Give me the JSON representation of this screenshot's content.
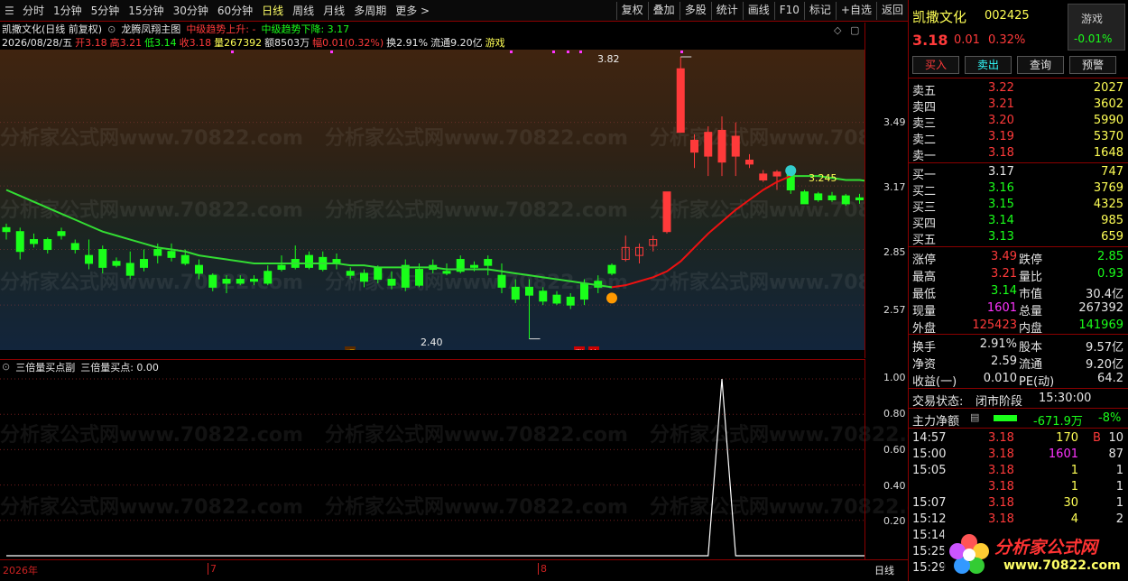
{
  "toolbar": {
    "left_items": [
      "分时",
      "1分钟",
      "5分钟",
      "15分钟",
      "30分钟",
      "60分钟",
      "日线",
      "周线",
      "月线",
      "多周期",
      "更多 >"
    ],
    "active_index": 6,
    "right_items": [
      "复权",
      "叠加",
      "多股",
      "统计",
      "画线",
      "F10",
      "标记",
      "+自选",
      "返回"
    ]
  },
  "title_line": {
    "name": "凯撒文化(日线 前复权)",
    "indicator": "龙腾凤翔主图",
    "trend_up": "中级趋势上升: -",
    "trend_down": "中级趋势下降: 3.17"
  },
  "bar_line": {
    "date": "2026/08/28/五",
    "open": "开3.18",
    "high": "高3.21",
    "low": "低3.14",
    "close": "收3.18",
    "volume": "量267392",
    "amount": "额8503万",
    "change": "幅0.01(0.32%)",
    "turnover": "换2.91%",
    "float": "流通9.20亿",
    "sector": "游戏"
  },
  "main_axis_labels": [
    "3.49",
    "3.17",
    "2.85",
    "2.57"
  ],
  "main_annotations": {
    "high_label": "3.82",
    "low_label": "2.40",
    "ma_label": "3.245",
    "mark_yu": "预",
    "mark_zhang": "涨",
    "mark_bang": "榜"
  },
  "watermark": "分析家公式网www.70822.com",
  "sub_header": {
    "indicator": "三倍量买点副",
    "value": "三倍量买点: 0.00"
  },
  "sub_axis_labels": [
    "1.00",
    "0.80",
    "0.60",
    "0.40",
    "0.20"
  ],
  "date_axis": {
    "labels": [
      "2026年",
      "7",
      "8"
    ],
    "period": "日线"
  },
  "chart_data": {
    "type": "candlestick",
    "candles": [
      {
        "o": 2.96,
        "c": 2.94,
        "h": 2.98,
        "l": 2.9
      },
      {
        "o": 2.94,
        "c": 2.84,
        "h": 2.96,
        "l": 2.8
      },
      {
        "o": 2.88,
        "c": 2.9,
        "h": 2.93,
        "l": 2.86
      },
      {
        "o": 2.9,
        "c": 2.85,
        "h": 2.91,
        "l": 2.83
      },
      {
        "o": 2.92,
        "c": 2.94,
        "h": 2.96,
        "l": 2.9
      },
      {
        "o": 2.88,
        "c": 2.85,
        "h": 2.9,
        "l": 2.83
      },
      {
        "o": 2.78,
        "c": 2.82,
        "h": 2.9,
        "l": 2.75
      },
      {
        "o": 2.85,
        "c": 2.76,
        "h": 2.87,
        "l": 2.73
      },
      {
        "o": 2.79,
        "c": 2.77,
        "h": 2.81,
        "l": 2.76
      },
      {
        "o": 2.78,
        "c": 2.72,
        "h": 2.84,
        "l": 2.7
      },
      {
        "o": 2.76,
        "c": 2.8,
        "h": 2.85,
        "l": 2.74
      },
      {
        "o": 2.82,
        "c": 2.85,
        "h": 2.88,
        "l": 2.78
      },
      {
        "o": 2.84,
        "c": 2.81,
        "h": 2.88,
        "l": 2.79
      },
      {
        "o": 2.82,
        "c": 2.78,
        "h": 2.85,
        "l": 2.77
      },
      {
        "o": 2.77,
        "c": 2.73,
        "h": 2.8,
        "l": 2.7
      },
      {
        "o": 2.66,
        "c": 2.72,
        "h": 2.73,
        "l": 2.64
      },
      {
        "o": 2.7,
        "c": 2.68,
        "h": 2.72,
        "l": 2.63
      },
      {
        "o": 2.68,
        "c": 2.7,
        "h": 2.72,
        "l": 2.67
      },
      {
        "o": 2.7,
        "c": 2.69,
        "h": 2.72,
        "l": 2.67
      },
      {
        "o": 2.68,
        "c": 2.74,
        "h": 2.77,
        "l": 2.67
      },
      {
        "o": 2.77,
        "c": 2.75,
        "h": 2.82,
        "l": 2.74
      },
      {
        "o": 2.8,
        "c": 2.76,
        "h": 2.87,
        "l": 2.75
      },
      {
        "o": 2.76,
        "c": 2.82,
        "h": 2.84,
        "l": 2.75
      },
      {
        "o": 2.81,
        "c": 2.75,
        "h": 2.84,
        "l": 2.74
      },
      {
        "o": 2.78,
        "c": 2.8,
        "h": 2.83,
        "l": 2.75
      },
      {
        "o": 2.72,
        "c": 2.74,
        "h": 2.76,
        "l": 2.7
      },
      {
        "o": 2.69,
        "c": 2.73,
        "h": 2.75,
        "l": 2.66
      },
      {
        "o": 2.7,
        "c": 2.76,
        "h": 2.77,
        "l": 2.68
      },
      {
        "o": 2.7,
        "c": 2.67,
        "h": 2.74,
        "l": 2.65
      },
      {
        "o": 2.77,
        "c": 2.66,
        "h": 2.8,
        "l": 2.64
      },
      {
        "o": 2.67,
        "c": 2.75,
        "h": 2.78,
        "l": 2.66
      },
      {
        "o": 2.77,
        "c": 2.75,
        "h": 2.8,
        "l": 2.73
      },
      {
        "o": 2.73,
        "c": 2.74,
        "h": 2.78,
        "l": 2.72
      },
      {
        "o": 2.74,
        "c": 2.8,
        "h": 2.82,
        "l": 2.73
      },
      {
        "o": 2.77,
        "c": 2.76,
        "h": 2.79,
        "l": 2.74
      },
      {
        "o": 2.8,
        "c": 2.77,
        "h": 2.82,
        "l": 2.72
      },
      {
        "o": 2.72,
        "c": 2.66,
        "h": 2.78,
        "l": 2.63
      },
      {
        "o": 2.66,
        "c": 2.6,
        "h": 2.7,
        "l": 2.58
      },
      {
        "o": 2.66,
        "c": 2.62,
        "h": 2.7,
        "l": 2.4
      },
      {
        "o": 2.64,
        "c": 2.59,
        "h": 2.66,
        "l": 2.57
      },
      {
        "o": 2.62,
        "c": 2.58,
        "h": 2.64,
        "l": 2.57
      },
      {
        "o": 2.61,
        "c": 2.57,
        "h": 2.63,
        "l": 2.55
      },
      {
        "o": 2.6,
        "c": 2.68,
        "h": 2.7,
        "l": 2.57
      },
      {
        "o": 2.66,
        "c": 2.69,
        "h": 2.72,
        "l": 2.63
      },
      {
        "o": 2.73,
        "c": 2.77,
        "h": 2.78,
        "l": 2.72
      },
      {
        "o": 2.8,
        "c": 2.86,
        "h": 2.92,
        "l": 2.79
      },
      {
        "o": 2.82,
        "c": 2.86,
        "h": 2.88,
        "l": 2.78
      },
      {
        "o": 2.87,
        "c": 2.9,
        "h": 2.92,
        "l": 2.84
      },
      {
        "o": 2.94,
        "c": 3.14,
        "h": 3.14,
        "l": 2.93
      },
      {
        "o": 3.44,
        "c": 3.76,
        "h": 3.82,
        "l": 3.44
      },
      {
        "o": 3.34,
        "c": 3.4,
        "h": 3.43,
        "l": 3.26
      },
      {
        "o": 3.32,
        "c": 3.44,
        "h": 3.47,
        "l": 3.22
      },
      {
        "o": 3.45,
        "c": 3.29,
        "h": 3.52,
        "l": 3.22
      },
      {
        "o": 3.32,
        "c": 3.42,
        "h": 3.49,
        "l": 3.22
      },
      {
        "o": 3.3,
        "c": 3.28,
        "h": 3.33,
        "l": 3.26
      },
      {
        "o": 3.2,
        "c": 3.23,
        "h": 3.25,
        "l": 3.19
      },
      {
        "o": 3.24,
        "c": 3.22,
        "h": 3.25,
        "l": 3.15
      },
      {
        "o": 3.23,
        "c": 3.15,
        "h": 3.23,
        "l": 3.13
      },
      {
        "o": 3.14,
        "c": 3.08,
        "h": 3.15,
        "l": 3.08
      },
      {
        "o": 3.13,
        "c": 3.1,
        "h": 3.14,
        "l": 3.09
      },
      {
        "o": 3.12,
        "c": 3.1,
        "h": 3.14,
        "l": 3.09
      },
      {
        "o": 3.12,
        "c": 3.08,
        "h": 3.13,
        "l": 3.07
      },
      {
        "o": 3.1,
        "c": 3.11,
        "h": 3.13,
        "l": 3.08
      },
      {
        "o": 3.16,
        "c": 3.09,
        "h": 3.16,
        "l": 3.08
      },
      {
        "o": 3.12,
        "c": 3.15,
        "h": 3.16,
        "l": 3.12
      },
      {
        "o": 3.16,
        "c": 3.18,
        "h": 3.18,
        "l": 3.16
      },
      {
        "o": 3.18,
        "c": 3.18,
        "h": 3.21,
        "l": 3.14
      }
    ],
    "red_indices": [
      45,
      46,
      47,
      48,
      49,
      50,
      51,
      52,
      53,
      54,
      55,
      56
    ],
    "ma_line": [
      3.15,
      3.12,
      3.09,
      3.06,
      3.03,
      3.0,
      2.97,
      2.94,
      2.92,
      2.9,
      2.88,
      2.86,
      2.85,
      2.84,
      2.82,
      2.81,
      2.8,
      2.79,
      2.78,
      2.78,
      2.78,
      2.78,
      2.78,
      2.78,
      2.78,
      2.77,
      2.77,
      2.76,
      2.76,
      2.76,
      2.76,
      2.76,
      2.75,
      2.75,
      2.75,
      2.75,
      2.74,
      2.73,
      2.72,
      2.71,
      2.7,
      2.69,
      2.68,
      2.67,
      2.66,
      2.67,
      2.69,
      2.71,
      2.74,
      2.79,
      2.86,
      2.93,
      2.99,
      3.05,
      3.1,
      3.15,
      3.19,
      3.22,
      3.22,
      3.22,
      3.21,
      3.2,
      3.2,
      3.19,
      3.18,
      3.18,
      3.17
    ],
    "ma_red_range": [
      44,
      57
    ],
    "y_range": [
      2.38,
      3.82
    ],
    "sub_series": {
      "name": "三倍量买点",
      "peak_index": 52,
      "y_range": [
        0,
        1.0
      ]
    }
  },
  "quote": {
    "name": "凯撒文化",
    "code": "002425",
    "price": "3.18",
    "change": "0.01",
    "change_pct": "0.32%",
    "sector_label": "游戏",
    "sector_change": "-0.01%"
  },
  "actions": [
    "买入",
    "卖出",
    "查询",
    "预警"
  ],
  "order_book": {
    "asks": [
      {
        "label": "卖五",
        "price": "3.22",
        "vol": "2027"
      },
      {
        "label": "卖四",
        "price": "3.21",
        "vol": "3602"
      },
      {
        "label": "卖三",
        "price": "3.20",
        "vol": "5990"
      },
      {
        "label": "卖二",
        "price": "3.19",
        "vol": "5370"
      },
      {
        "label": "卖一",
        "price": "3.18",
        "vol": "1648"
      }
    ],
    "bids": [
      {
        "label": "买一",
        "price": "3.17",
        "vol": "747"
      },
      {
        "label": "买二",
        "price": "3.16",
        "vol": "3769"
      },
      {
        "label": "买三",
        "price": "3.15",
        "vol": "4325"
      },
      {
        "label": "买四",
        "price": "3.14",
        "vol": "985"
      },
      {
        "label": "买五",
        "price": "3.13",
        "vol": "659"
      }
    ]
  },
  "stats1": [
    {
      "l1": "涨停",
      "v1": "3.49",
      "c1": "red",
      "l2": "跌停",
      "v2": "2.85",
      "c2": "green"
    },
    {
      "l1": "最高",
      "v1": "3.21",
      "c1": "red",
      "l2": "量比",
      "v2": "0.93",
      "c2": "green"
    },
    {
      "l1": "最低",
      "v1": "3.14",
      "c1": "green",
      "l2": "市值",
      "v2": "30.4亿",
      "c2": "white"
    },
    {
      "l1": "现量",
      "v1": "1601",
      "c1": "magenta",
      "l2": "总量",
      "v2": "267392",
      "c2": "white"
    },
    {
      "l1": "外盘",
      "v1": "125423",
      "c1": "red",
      "l2": "内盘",
      "v2": "141969",
      "c2": "green"
    }
  ],
  "stats2": [
    {
      "l1": "换手",
      "v1": "2.91%",
      "l2": "股本",
      "v2": "9.57亿"
    },
    {
      "l1": "净资",
      "v1": "2.59",
      "l2": "流通",
      "v2": "9.20亿"
    },
    {
      "l1": "收益(一)",
      "v1": "0.010",
      "l2": "PE(动)",
      "v2": "64.2"
    }
  ],
  "trade_status": {
    "label": "交易状态:",
    "value": "闭市阶段",
    "time": "15:30:00"
  },
  "main_flow": {
    "label": "主力净额",
    "value": "-671.9万",
    "pct": "-8%"
  },
  "ticks": [
    {
      "time": "14:57",
      "price": "3.18",
      "vol": "170",
      "flag": "B",
      "n": "10"
    },
    {
      "time": "15:00",
      "price": "3.18",
      "vol": "1601",
      "flag": "",
      "n": "87"
    },
    {
      "time": "15:05",
      "price": "3.18",
      "vol": "1",
      "flag": "",
      "n": "1"
    },
    {
      "time": "",
      "price": "3.18",
      "vol": "1",
      "flag": "",
      "n": "1"
    },
    {
      "time": "15:07",
      "price": "3.18",
      "vol": "30",
      "flag": "",
      "n": "1"
    },
    {
      "time": "15:12",
      "price": "3.18",
      "vol": "4",
      "flag": "",
      "n": "2"
    },
    {
      "time": "15:14",
      "price": "",
      "vol": "",
      "flag": "",
      "n": ""
    },
    {
      "time": "15:25",
      "price": "",
      "vol": "",
      "flag": "",
      "n": ""
    },
    {
      "time": "15:29",
      "price": "",
      "vol": "",
      "flag": "",
      "n": ""
    }
  ],
  "logo": {
    "title": "分析家公式网",
    "url": "www.70822.com"
  },
  "colors": {
    "up": "#ff3a3a",
    "down": "#1aff1a",
    "ma_down": "#33dd33",
    "ma_up": "#ee1111",
    "sub_line": "#ffffff",
    "border": "#8b0000"
  }
}
